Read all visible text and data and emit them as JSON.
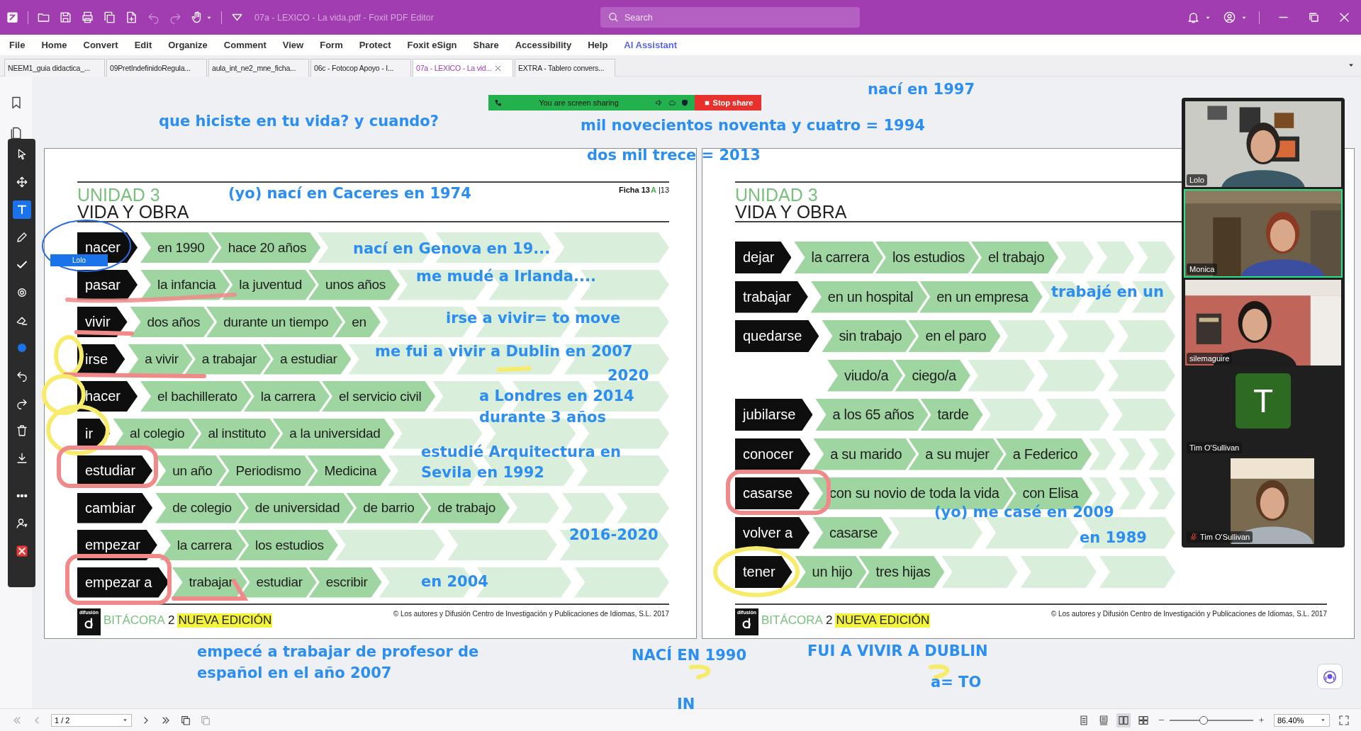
{
  "window": {
    "title": "07a - LEXICO - La vida.pdf - Foxit PDF Editor"
  },
  "search": {
    "placeholder": "Search"
  },
  "menu": [
    {
      "label": "File",
      "kind": "menu"
    },
    {
      "label": "Home",
      "kind": "menu"
    },
    {
      "label": "Convert",
      "kind": "menu"
    },
    {
      "label": "Edit",
      "kind": "menu"
    },
    {
      "label": "Organize",
      "kind": "menu"
    },
    {
      "label": "Comment",
      "kind": "menu"
    },
    {
      "label": "View",
      "kind": "menu"
    },
    {
      "label": "Form",
      "kind": "menu"
    },
    {
      "label": "Protect",
      "kind": "menu"
    },
    {
      "label": "Foxit eSign",
      "kind": "menu"
    },
    {
      "label": "Share",
      "kind": "menu"
    },
    {
      "label": "Accessibility",
      "kind": "menu"
    },
    {
      "label": "Help",
      "kind": "menu"
    },
    {
      "label": "AI Assistant",
      "kind": "ai"
    }
  ],
  "tabs": [
    {
      "label": "NEEM1_guia didactica_...",
      "selected": false
    },
    {
      "label": "09PretIndefinidoRegula...",
      "selected": false
    },
    {
      "label": "aula_int_ne2_mne_ficha...",
      "selected": false
    },
    {
      "label": "06c - Fotocop Apoyo - I...",
      "selected": false
    },
    {
      "label": "07a - LEXICO - La vid...",
      "selected": true
    },
    {
      "label": "EXTRA - Tablero convers...",
      "selected": false
    }
  ],
  "share_bar": {
    "status": "You are screen sharing",
    "button": "Stop share"
  },
  "pages": [
    {
      "unit": "UNIDAD 3",
      "title": "VIDA Y OBRA",
      "sheet": {
        "label": "Ficha 13",
        "letter": "A",
        "page": "|13"
      },
      "rows": [
        {
          "verb": "nacer",
          "phrases": [
            "en 1990",
            "hace 20 años"
          ]
        },
        {
          "verb": "pasar",
          "phrases": [
            "la infancia",
            "la juventud",
            "unos años"
          ]
        },
        {
          "verb": "vivir",
          "phrases": [
            "dos años",
            "durante un tiempo",
            "en"
          ]
        },
        {
          "verb": "irse",
          "phrases": [
            "a vivir",
            "a trabajar",
            "a estudiar"
          ]
        },
        {
          "verb": "hacer",
          "phrases": [
            "el bachillerato",
            "la carrera",
            "el servicio civil"
          ]
        },
        {
          "verb": "ir",
          "phrases": [
            "al colegio",
            "al instituto",
            "a la universidad"
          ]
        },
        {
          "verb": "estudiar",
          "phrases": [
            "un año",
            "Periodismo",
            "Medicina"
          ]
        },
        {
          "verb": "cambiar",
          "phrases": [
            "de colegio",
            "de universidad",
            "de barrio",
            "de trabajo"
          ]
        },
        {
          "verb": "empezar",
          "phrases": [
            "la carrera",
            "los estudios"
          ]
        },
        {
          "verb": "empezar a",
          "phrases": [
            "trabajar",
            "estudiar",
            "escribir"
          ]
        }
      ],
      "footer": {
        "publisher": "difusión",
        "series": "BITÁCORA",
        "number": "2",
        "edition": "NUEVA EDICIÓN",
        "copyright": "© Los autores y Difusión Centro de Investigación y Publicaciones de Idiomas, S.L. 2017"
      }
    },
    {
      "unit": "UNIDAD 3",
      "title": "VIDA Y OBRA",
      "rows": [
        {
          "verb": "dejar",
          "phrases": [
            "la carrera",
            "los estudios",
            "el trabajo"
          ]
        },
        {
          "verb": "trabajar",
          "phrases": [
            "en un hospital",
            "en un empresa"
          ]
        },
        {
          "verb": "quedarse",
          "phrases": [
            "sin trabajo",
            "en el paro"
          ]
        },
        {
          "phrases": [
            "viudo/a",
            "ciego/a"
          ]
        },
        {
          "verb": "jubilarse",
          "phrases": [
            "a los 65 años",
            "tarde"
          ]
        },
        {
          "verb": "conocer",
          "phrases": [
            "a su marido",
            "a su mujer",
            "a Federico"
          ]
        },
        {
          "verb": "casarse",
          "phrases": [
            "con su novio de toda la vida",
            "con Elisa"
          ]
        },
        {
          "verb": "volver a",
          "phrases": [
            "casarse"
          ]
        },
        {
          "verb": "tener",
          "phrases": [
            "un hijo",
            "tres hijas"
          ]
        }
      ],
      "footer": {
        "publisher": "difusión",
        "series": "BITÁCORA",
        "number": "2",
        "edition": "NUEVA EDICIÓN",
        "copyright": "© Los autores y Difusión Centro de Investigación y Publicaciones de Idiomas, S.L. 2017"
      }
    }
  ],
  "annotations": [
    {
      "text": "nací en 1997"
    },
    {
      "text": "que hiciste en tu vida? y cuando?"
    },
    {
      "text": "mil novecientos noventa y cuatro = 1994"
    },
    {
      "text": "dos mil trece = 2013"
    },
    {
      "text": "(yo) nací en Caceres en 1974"
    },
    {
      "text": "nací en Genova en 19..."
    },
    {
      "text": "me mudé a Irlanda...."
    },
    {
      "text": "irse a vivir= to move"
    },
    {
      "text": "me fui a vivir a Dublin en 2007"
    },
    {
      "text": "2020"
    },
    {
      "text": "a Londres en 2014"
    },
    {
      "text": "durante 3 años"
    },
    {
      "text": "estudié Arquitectura en"
    },
    {
      "text": "Sevila en 1992"
    },
    {
      "text": "2016-2020"
    },
    {
      "text": "en 2004"
    },
    {
      "text": "trabajé en un"
    },
    {
      "text": "(yo)  me casé en 2009"
    },
    {
      "text": "en 1989"
    },
    {
      "text": "empecé a trabajar de profesor de"
    },
    {
      "text": "español en el año 2007"
    },
    {
      "text": "NACÍ EN 1990"
    },
    {
      "text": "FUI A VIVIR A DUBLIN"
    },
    {
      "text": "a= TO"
    },
    {
      "text": "IN"
    }
  ],
  "cursor_label": "Lolo",
  "participants": [
    {
      "name": "Lolo",
      "kind": "video",
      "selected": false,
      "muted": false
    },
    {
      "name": "Monica",
      "kind": "video",
      "selected": true,
      "muted": false
    },
    {
      "name": "silemaguire",
      "kind": "video",
      "selected": false,
      "muted": false
    },
    {
      "name": "Tim O'Sullivan",
      "kind": "avatar",
      "initial": "T",
      "selected": false,
      "muted": false
    },
    {
      "name": "Tim O'Sullivan",
      "kind": "video",
      "selected": false,
      "muted": true
    }
  ],
  "pager": {
    "page": "1 / 2"
  },
  "zoom": {
    "level": 0.41,
    "value": "86.40%"
  }
}
